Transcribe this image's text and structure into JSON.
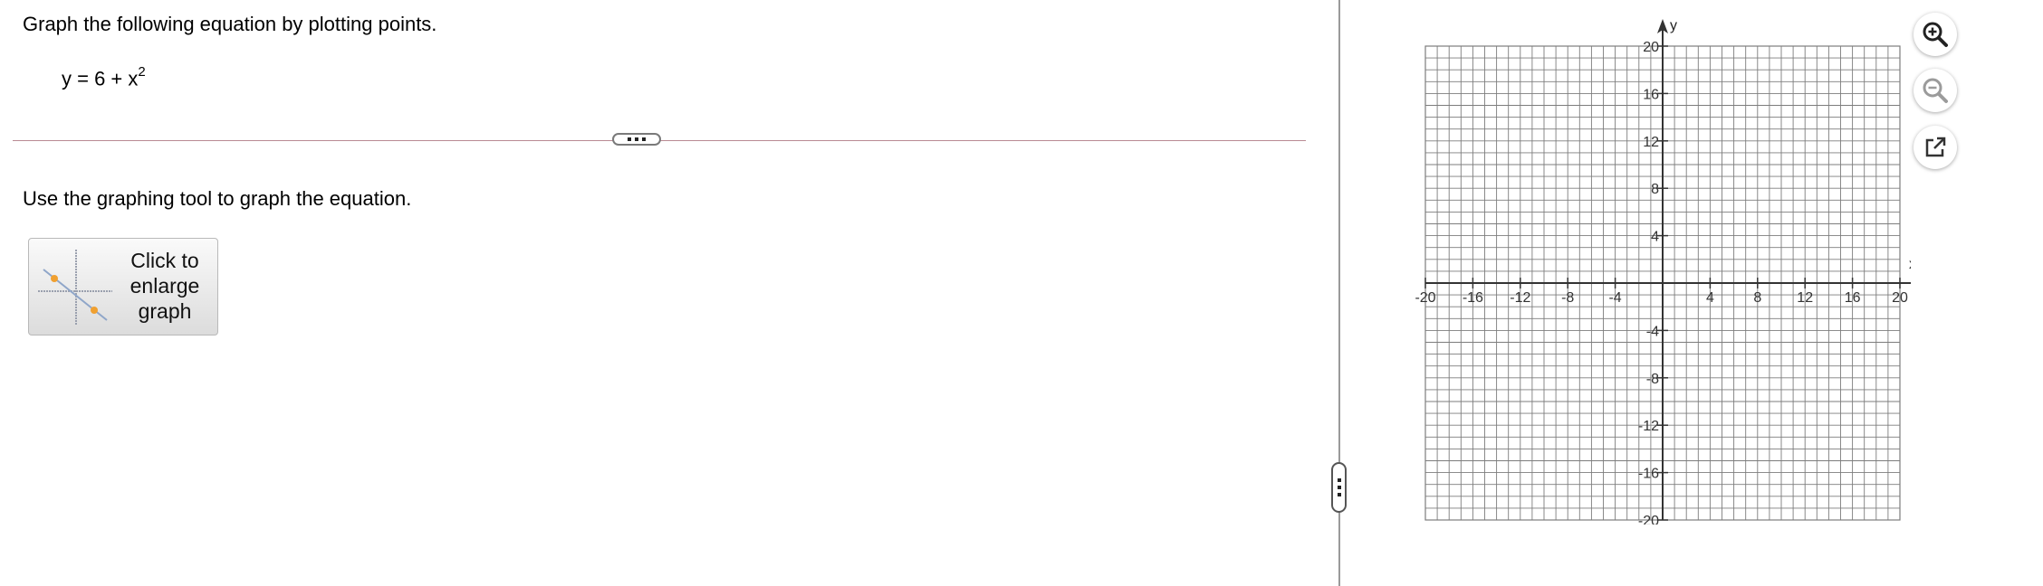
{
  "question": {
    "instruction": "Graph the following equation by plotting points.",
    "equation_base": "y = 6 + x",
    "equation_exponent": "2"
  },
  "tool_instruction": "Use the graphing tool to graph the equation.",
  "enlarge_button": {
    "line1": "Click to",
    "line2": "enlarge",
    "line3": "graph"
  },
  "graph": {
    "x_axis_label": "x",
    "y_axis_label": "y",
    "x_ticks": [
      "-20",
      "-16",
      "-12",
      "-8",
      "-4",
      "4",
      "8",
      "12",
      "16",
      "20"
    ],
    "y_ticks": [
      "20",
      "16",
      "12",
      "8",
      "4",
      "-4",
      "-8",
      "-12",
      "-16",
      "-20"
    ],
    "x_range": [
      -20,
      20
    ],
    "y_range": [
      -20,
      20
    ],
    "grid_step": 1,
    "grid": true
  },
  "tools": {
    "zoom_in": "zoom-in-icon",
    "zoom_out": "zoom-out-icon",
    "popout": "popout-icon"
  },
  "colors": {
    "grid_line": "#7d7d7d",
    "axis": "#333333",
    "divider": "#b98a93",
    "thumb_point": "#f0a030"
  }
}
